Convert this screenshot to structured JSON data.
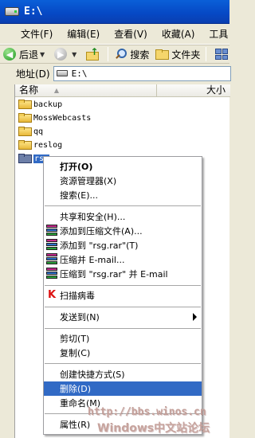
{
  "window": {
    "title": "E:\\",
    "drive_icon": "drive-icon"
  },
  "menu": [
    "文件(F)",
    "编辑(E)",
    "查看(V)",
    "收藏(A)",
    "工具"
  ],
  "toolbar": {
    "back": "后退",
    "search": "搜索",
    "folders": "文件夹"
  },
  "address": {
    "label": "地址(D)",
    "value": "E:\\"
  },
  "columns": {
    "name": "名称",
    "size": "大小"
  },
  "files": [
    {
      "name": "backup"
    },
    {
      "name": "MossWebcasts"
    },
    {
      "name": "qq"
    },
    {
      "name": "reslog"
    },
    {
      "name": "rsg",
      "selected": true
    }
  ],
  "context_menu": {
    "open": "打开(O)",
    "explorer": "资源管理器(X)",
    "search": "搜索(E)...",
    "sharing": "共享和安全(H)...",
    "add_to_archive": "添加到压缩文件(A)...",
    "add_to_rsg_rar": "添加到 \"rsg.rar\"(T)",
    "compress_email": "压缩并 E-mail...",
    "compress_rsg_email": "压缩到 \"rsg.rar\" 并 E-mail",
    "scan_virus": "扫描病毒",
    "send_to": "发送到(N)",
    "cut": "剪切(T)",
    "copy": "复制(C)",
    "create_shortcut": "创建快捷方式(S)",
    "delete": "删除(D)",
    "rename": "重命名(M)",
    "properties": "属性(R)"
  },
  "watermark": {
    "url": "http://bbs.winos.cn",
    "site": "Windows中文站论坛"
  },
  "colors": {
    "highlight": "#316ac5",
    "titlebar": "#0a5fd8"
  }
}
